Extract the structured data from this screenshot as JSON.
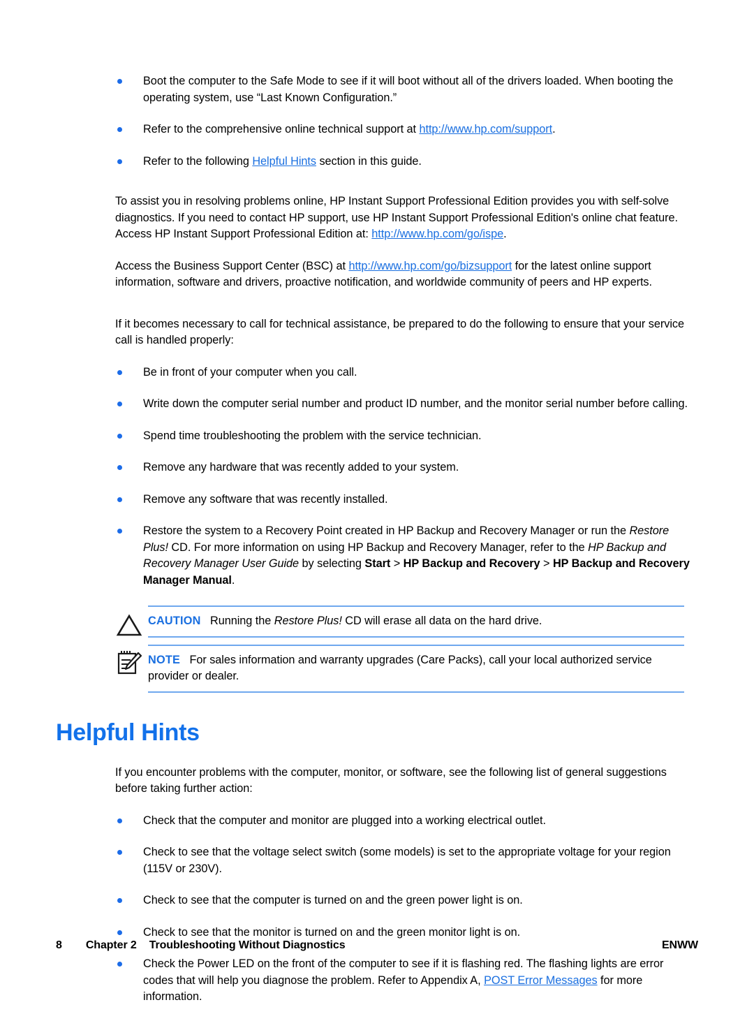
{
  "document": {
    "intro_bullets": [
      {
        "id": "safe-mode",
        "text_1": "Boot the computer to the Safe Mode to see if it will boot without all of the drivers loaded. When booting the operating system, use “Last Known Configuration.”"
      },
      {
        "id": "online-support",
        "text_1": "Refer to the comprehensive online technical support at ",
        "link": "http://www.hp.com/support",
        "text_2": "."
      },
      {
        "id": "helpful-hints-ref",
        "text_1": "Refer to the following ",
        "link": "Helpful Hints",
        "text_2": " section in this guide."
      }
    ],
    "paragraphs": [
      {
        "id": "instant-support",
        "text_1": "To assist you in resolving problems online, HP Instant Support Professional Edition provides you with self-solve diagnostics. If you need to contact HP support, use HP Instant Support Professional Edition's online chat feature. Access HP Instant Support Professional Edition at: ",
        "link": "http://www.hp.com/go/ispe",
        "text_2": "."
      },
      {
        "id": "business-support-center",
        "text_1": "Access the Business Support Center (BSC) at ",
        "link": "http://www.hp.com/go/bizsupport",
        "text_2": " for the latest online support information, software and drivers, proactive notification, and worldwide community of peers and HP experts."
      },
      {
        "id": "technical-assistance",
        "text_1": "If it becomes necessary to call for technical assistance, be prepared to do the following to ensure that your service call is handled properly:"
      }
    ],
    "call_prep_bullets": [
      {
        "id": "be-in-front",
        "text_1": "Be in front of your computer when you call."
      },
      {
        "id": "write-serial",
        "text_1": "Write down the computer serial number and product ID number, and the monitor serial number before calling."
      },
      {
        "id": "spend-time",
        "text_1": "Spend time troubleshooting the problem with the service technician."
      },
      {
        "id": "remove-hardware",
        "text_1": "Remove any hardware that was recently added to your system."
      },
      {
        "id": "remove-software",
        "text_1": "Remove any software that was recently installed."
      },
      {
        "id": "restore-recovery-point",
        "text_1": "Restore the system to a Recovery Point created in HP Backup and Recovery Manager or run the ",
        "italic_1": "Restore Plus!",
        "text_2": " CD. For more information on using HP Backup and Recovery Manager, refer to the ",
        "italic_2": "HP Backup and Recovery Manager User Guide",
        "text_3": " by selecting ",
        "bold_1": "Start",
        "text_4": " > ",
        "bold_2": "HP Backup and Recovery",
        "text_5": " > ",
        "bold_3": "HP Backup and Recovery Manager Manual",
        "text_6": "."
      }
    ],
    "caution": {
      "label": "CAUTION",
      "text_1": "Running the ",
      "italic_1": "Restore Plus!",
      "text_2": " CD will erase all data on the hard drive."
    },
    "note": {
      "label": "NOTE",
      "text_1": "For sales information and warranty upgrades (Care Packs), call your local authorized service provider or dealer."
    },
    "section": {
      "title": "Helpful Hints",
      "intro": "If you encounter problems with the computer, monitor, or software, see the following list of general suggestions before taking further action:",
      "bullets": [
        {
          "id": "plugged-in",
          "text_1": "Check that the computer and monitor are plugged into a working electrical outlet."
        },
        {
          "id": "voltage-switch",
          "text_1": "Check to see that the voltage select switch (some models) is set to the appropriate voltage for your region (115V or 230V)."
        },
        {
          "id": "computer-power-light",
          "text_1": "Check to see that the computer is turned on and the green power light is on."
        },
        {
          "id": "monitor-light",
          "text_1": "Check to see that the monitor is turned on and the green monitor light is on."
        },
        {
          "id": "power-led-flashing",
          "text_1": "Check the Power LED on the front of the computer to see if it is flashing red. The flashing lights are error codes that will help you diagnose the problem. Refer to Appendix A, ",
          "link": "POST Error Messages",
          "text_2": " for more information."
        }
      ]
    },
    "footer": {
      "page_number": "8",
      "chapter": "Chapter 2",
      "chapter_title": "Troubleshooting Without Diagnostics",
      "locale": "ENWW"
    },
    "colors": {
      "link": "#1a6fe0",
      "heading": "#1271ea",
      "bullet": "#1c6ce8",
      "rule": "#6fa8ee",
      "text": "#000000"
    },
    "icons": {
      "caution": "warning-triangle-icon",
      "note": "notepad-pencil-icon"
    }
  }
}
